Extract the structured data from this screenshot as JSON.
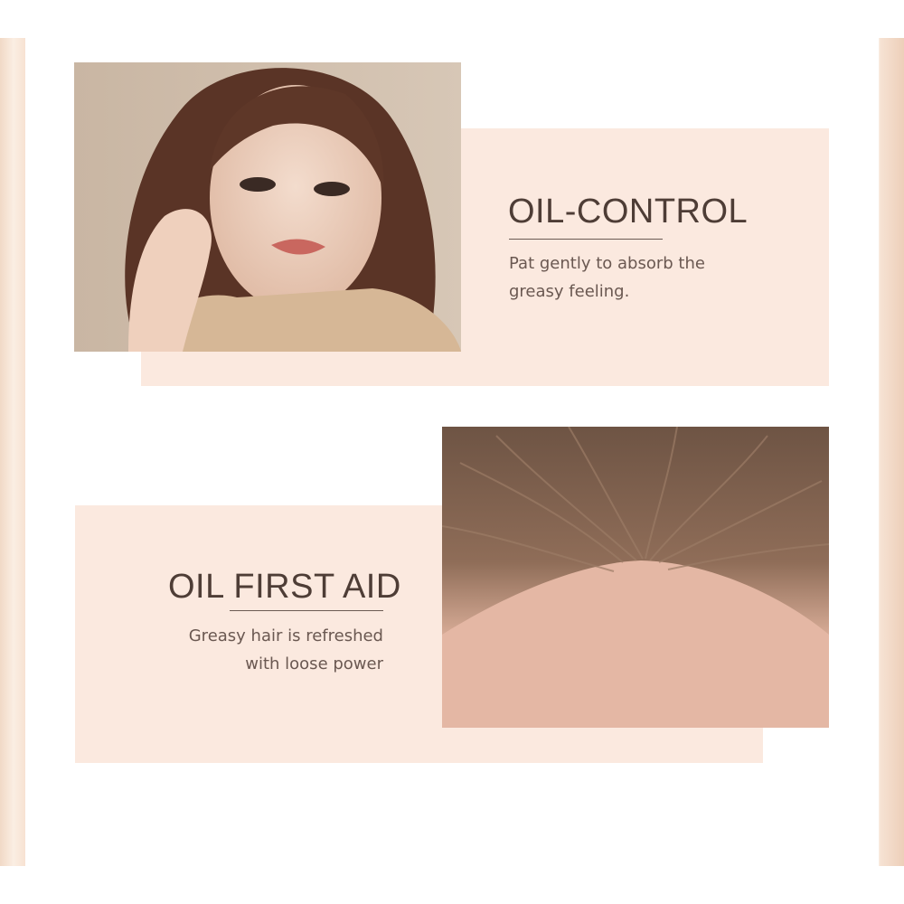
{
  "feature_1": {
    "title": "OIL-CONTROL",
    "description_lines": [
      "Pat gently to absorb the",
      "greasy feeling."
    ],
    "image": "woman-portrait"
  },
  "feature_2": {
    "title": "OIL FIRST AID",
    "description_lines": [
      "Greasy hair is refreshed",
      "with loose power"
    ],
    "image": "hair-scalp-closeup"
  },
  "colors": {
    "panel": "#fbe9df",
    "text_dark": "#4e3d36",
    "text_body": "#6a5851"
  }
}
